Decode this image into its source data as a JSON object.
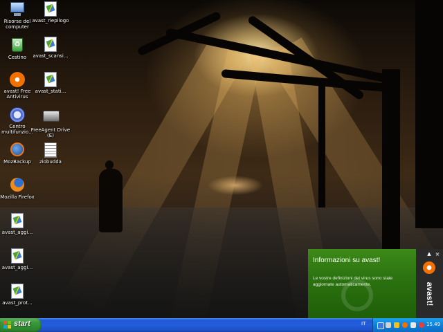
{
  "desktop": {
    "icons": [
      {
        "label": "Risorse del computer",
        "icon": "my-computer-icon"
      },
      {
        "label": "avast_riepilogo",
        "icon": "document-icon"
      },
      {
        "label": "Cestino",
        "icon": "recycle-bin-icon"
      },
      {
        "label": "avast_scansi...",
        "icon": "document-icon"
      },
      {
        "label": "avast! Free Antivirus",
        "icon": "avast-icon"
      },
      {
        "label": "avast_stati...",
        "icon": "document-icon"
      },
      {
        "label": "Centro multifunzio...",
        "icon": "centro-icon"
      },
      {
        "label": "FreeAgent Drive (E)",
        "icon": "drive-icon"
      },
      {
        "label": "MozBackup",
        "icon": "mozbackup-icon"
      },
      {
        "label": "ziobudda",
        "icon": "text-file-icon"
      },
      {
        "label": "Mozilla Firefox",
        "icon": "firefox-icon"
      },
      {
        "label": "avast_aggi...",
        "icon": "document-icon"
      },
      {
        "label": "avast_aggi...",
        "icon": "document-icon"
      },
      {
        "label": "avast_prot...",
        "icon": "document-icon"
      }
    ]
  },
  "popup": {
    "title": "Informazioni su avast!",
    "body": "Le vostre definizioni dei virus sono state aggiornate automaticamente.",
    "logo": "avast!",
    "close_glyph": "×",
    "pin_glyph": "▲",
    "accent": "#2c7310"
  },
  "taskbar": {
    "start_label": "start",
    "language": "IT",
    "clock": "15.49"
  }
}
